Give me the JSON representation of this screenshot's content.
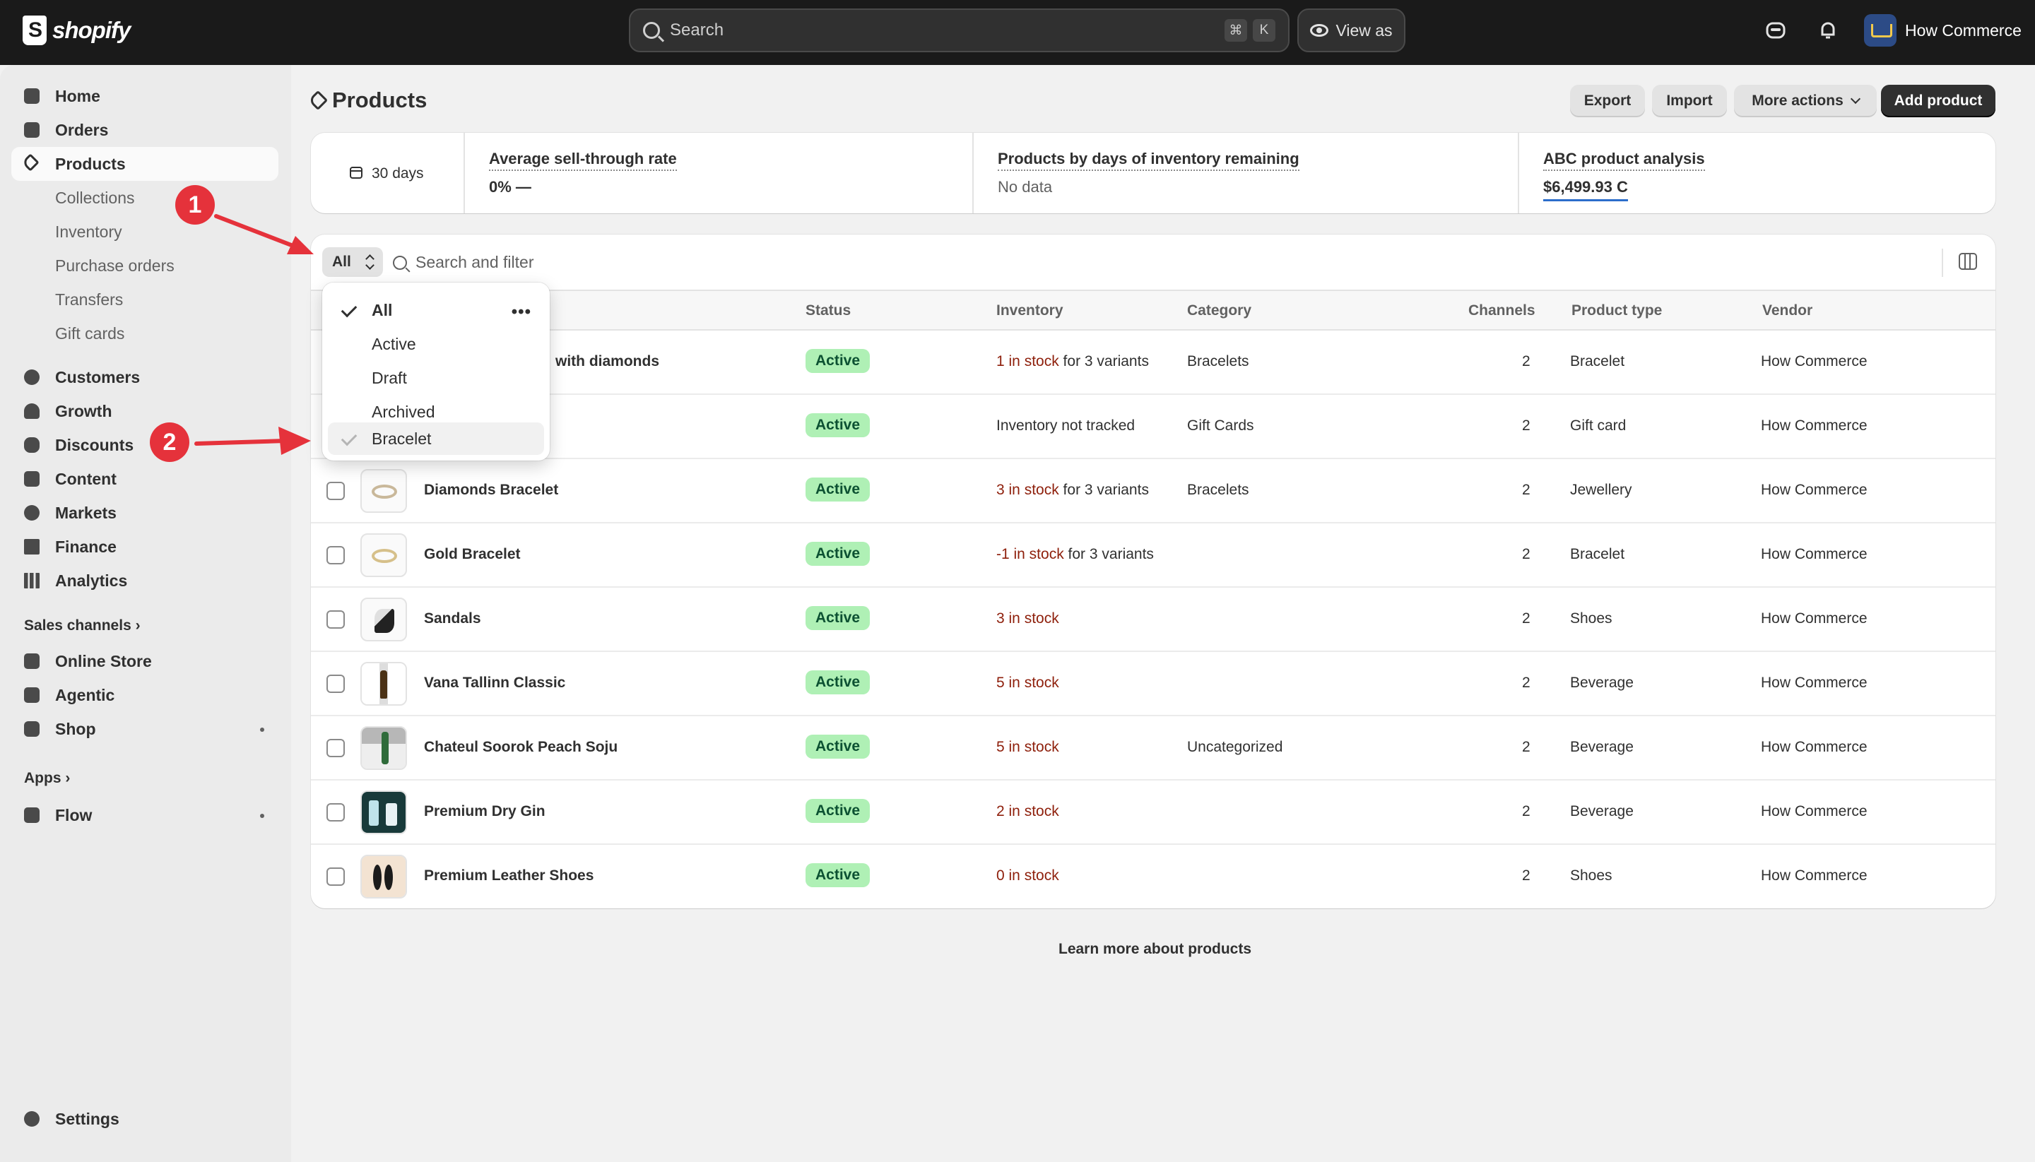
{
  "topbar": {
    "logo_text": "shopify",
    "search_placeholder": "Search",
    "search_shortcut": [
      "⌘",
      "K"
    ],
    "view_as_label": "View as",
    "store_name": "How Commerce"
  },
  "sidebar": {
    "items": [
      {
        "label": "Home",
        "icon": "home-icon"
      },
      {
        "label": "Orders",
        "icon": "inbox-icon"
      },
      {
        "label": "Products",
        "icon": "tag-icon",
        "active": true
      },
      {
        "label": "Collections",
        "sub": true
      },
      {
        "label": "Inventory",
        "sub": true
      },
      {
        "label": "Purchase orders",
        "sub": true
      },
      {
        "label": "Transfers",
        "sub": true
      },
      {
        "label": "Gift cards",
        "sub": true
      },
      {
        "label": "Customers",
        "icon": "person-icon"
      },
      {
        "label": "Growth",
        "icon": "gauge-icon"
      },
      {
        "label": "Discounts",
        "icon": "discount-icon"
      },
      {
        "label": "Content",
        "icon": "content-icon"
      },
      {
        "label": "Markets",
        "icon": "globe-icon"
      },
      {
        "label": "Finance",
        "icon": "bank-icon"
      },
      {
        "label": "Analytics",
        "icon": "bar-chart-icon"
      }
    ],
    "sales_channels_label": "Sales channels",
    "channels": [
      {
        "label": "Online Store",
        "icon": "store-icon"
      },
      {
        "label": "Agentic",
        "icon": "agentic-icon"
      },
      {
        "label": "Shop",
        "icon": "shop-icon"
      }
    ],
    "apps_label": "Apps",
    "apps": [
      {
        "label": "Flow",
        "icon": "flow-icon"
      }
    ],
    "settings_label": "Settings"
  },
  "page": {
    "title": "Products",
    "actions": {
      "export": "Export",
      "import": "Import",
      "more": "More actions",
      "add": "Add product"
    }
  },
  "metrics": {
    "date_range": "30 days",
    "cells": [
      {
        "label": "Average sell-through rate",
        "value": "0% —"
      },
      {
        "label": "Products by days of inventory remaining",
        "value": "No data"
      },
      {
        "label": "ABC product analysis",
        "value": "$6,499.93 C"
      }
    ]
  },
  "filter": {
    "selected": "All",
    "search_placeholder": "Search and filter",
    "dropdown": [
      "All",
      "Active",
      "Draft",
      "Archived",
      "Bracelet"
    ]
  },
  "table": {
    "headers": {
      "status": "Status",
      "inventory": "Inventory",
      "category": "Category",
      "channels": "Channels",
      "type": "Product type",
      "vendor": "Vendor"
    },
    "rows": [
      {
        "name": "with diamonds",
        "status": "Active",
        "stock": "1 in stock",
        "stock_extra": " for 3 variants",
        "category": "Bracelets",
        "channels": "2",
        "type": "Bracelet",
        "vendor": "How Commerce"
      },
      {
        "name": "",
        "status": "Active",
        "stock": "",
        "stock_extra": "Inventory not tracked",
        "category": "Gift Cards",
        "channels": "2",
        "type": "Gift card",
        "vendor": "How Commerce"
      },
      {
        "name": "Diamonds Bracelet",
        "status": "Active",
        "stock": "3 in stock",
        "stock_extra": " for 3 variants",
        "category": "Bracelets",
        "channels": "2",
        "type": "Jewellery",
        "vendor": "How Commerce"
      },
      {
        "name": "Gold Bracelet",
        "status": "Active",
        "stock": "-1 in stock",
        "stock_extra": " for 3 variants",
        "category": "",
        "channels": "2",
        "type": "Bracelet",
        "vendor": "How Commerce"
      },
      {
        "name": "Sandals",
        "status": "Active",
        "stock": "3 in stock",
        "stock_extra": "",
        "category": "",
        "channels": "2",
        "type": "Shoes",
        "vendor": "How Commerce"
      },
      {
        "name": "Vana Tallinn Classic",
        "status": "Active",
        "stock": "5 in stock",
        "stock_extra": "",
        "category": "",
        "channels": "2",
        "type": "Beverage",
        "vendor": "How Commerce"
      },
      {
        "name": "Chateul Soorok Peach Soju",
        "status": "Active",
        "stock": "5 in stock",
        "stock_extra": "",
        "category": "Uncategorized",
        "channels": "2",
        "type": "Beverage",
        "vendor": "How Commerce"
      },
      {
        "name": "Premium Dry Gin",
        "status": "Active",
        "stock": "2 in stock",
        "stock_extra": "",
        "category": "",
        "channels": "2",
        "type": "Beverage",
        "vendor": "How Commerce"
      },
      {
        "name": "Premium Leather Shoes",
        "status": "Active",
        "stock": "0 in stock",
        "stock_extra": "",
        "category": "",
        "channels": "2",
        "type": "Shoes",
        "vendor": "How Commerce"
      }
    ]
  },
  "footer": {
    "learn_more": "Learn more about products"
  },
  "annotations": [
    "1",
    "2"
  ],
  "colors": {
    "accent_red": "#e5323b",
    "active_badge_bg": "#aff0b5",
    "active_badge_text": "#0c5132",
    "stock_text": "#8e1f0b"
  }
}
